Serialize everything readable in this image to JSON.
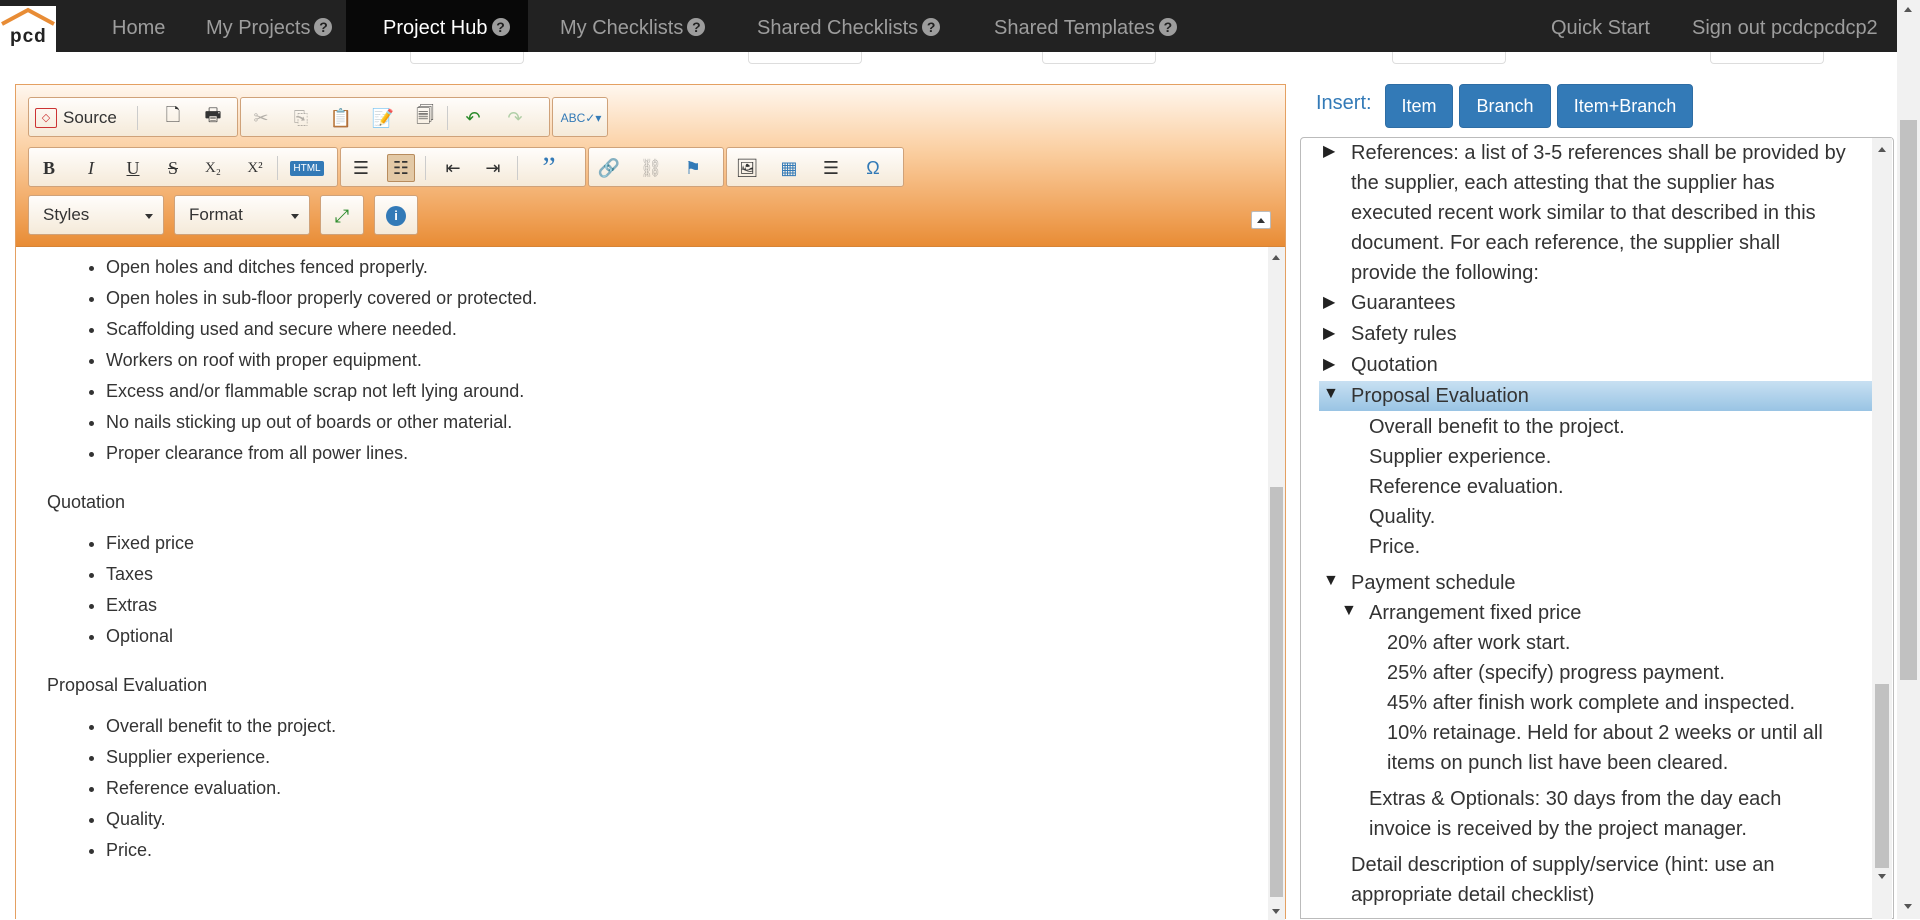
{
  "nav": {
    "logo_text": "pcd",
    "home": "Home",
    "my_projects": "My Projects",
    "project_hub": "Project Hub",
    "my_checklists": "My Checklists",
    "shared_checklists": "Shared Checklists",
    "shared_templates": "Shared Templates",
    "quick_start": "Quick Start",
    "sign_out": "Sign out pcdcpcdcp2",
    "help_glyph": "?"
  },
  "toolbar": {
    "source_label": "Source",
    "styles_label": "Styles",
    "format_label": "Format",
    "bold": "B",
    "italic": "I",
    "underline": "U",
    "strike": "S",
    "subscript": "X₂",
    "superscript": "X²",
    "blockquote": "”",
    "special_char": "Ω"
  },
  "document": {
    "list1": [
      "Open holes and ditches fenced properly.",
      "Open holes in sub-floor properly covered or protected.",
      "Scaffolding used and secure where needed.",
      "Workers on roof with proper equipment.",
      "Excess and/or flammable scrap not left lying around.",
      "No nails sticking up out of boards or other material.",
      "Proper clearance from all power lines."
    ],
    "heading_quotation": "Quotation",
    "list2": [
      "Fixed price",
      "Taxes",
      "Extras",
      "Optional"
    ],
    "heading_proposal": "Proposal Evaluation",
    "list3": [
      "Overall benefit to the project.",
      "Supplier experience.",
      "Reference evaluation.",
      "Quality.",
      "Price."
    ]
  },
  "insert": {
    "label": "Insert:",
    "item": "Item",
    "branch": "Branch",
    "item_branch": "Item+Branch"
  },
  "tree": {
    "references": [
      "References: a list of 3-5 references shall be provided by",
      "the supplier, each attesting that the supplier has",
      "executed recent work similar to that described in this",
      "document. For each reference, the supplier shall",
      "provide the following:"
    ],
    "guarantees": "Guarantees",
    "safety_rules": "Safety rules",
    "quotation": "Quotation",
    "proposal_evaluation": "Proposal Evaluation",
    "proposal_children": [
      "Overall benefit to the project.",
      "Supplier experience.",
      "Reference evaluation.",
      "Quality.",
      "Price."
    ],
    "payment_schedule": "Payment schedule",
    "arrangement_fixed_price": "Arrangement fixed price",
    "arrangement_children": [
      "20% after work start.",
      "25% after (specify) progress payment.",
      "45% after finish work complete and inspected.",
      "10% retainage. Held for about 2 weeks or until all",
      "items on punch list have been cleared."
    ],
    "extras_optionals": [
      "Extras & Optionals: 30 days from the day each",
      "invoice is received by the project manager."
    ],
    "detail_description": [
      "Detail description of supply/service (hint: use an",
      "appropriate detail checklist)"
    ],
    "collapsed_glyph": "▶",
    "expanded_glyph": "▼"
  },
  "colors": {
    "nav_bg": "#222222",
    "accent_blue": "#337ab7",
    "toolbar_orange": "#e88c35",
    "selection_blue": "#99c4e4"
  }
}
